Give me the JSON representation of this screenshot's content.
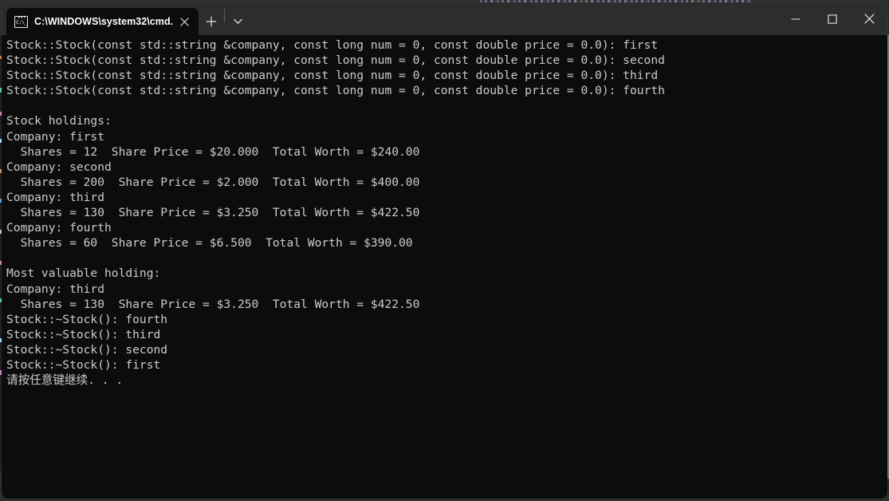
{
  "window": {
    "title": "C:\\WINDOWS\\system32\\cmd.",
    "controls": {
      "minimize_label": "Minimize",
      "maximize_label": "Maximize",
      "close_label": "Close"
    }
  },
  "tabbar": {
    "tabs": [
      {
        "title": "C:\\WINDOWS\\system32\\cmd.",
        "icon": "cmd-icon",
        "icon_text": "C:\\_",
        "active": true,
        "close_label": "Close tab"
      }
    ],
    "new_tab_label": "+",
    "dropdown_label": "Open new tab dropdown"
  },
  "colors": {
    "titlebar_bg": "#2d2d2d",
    "tab_active_bg": "#0c0c0c",
    "terminal_bg": "#0c0c0c",
    "terminal_fg": "#cccccc",
    "accent_text": "#ffffff"
  },
  "terminal": {
    "lines": [
      "Stock::Stock(const std::string &company, const long num = 0, const double price = 0.0): first",
      "Stock::Stock(const std::string &company, const long num = 0, const double price = 0.0): second",
      "Stock::Stock(const std::string &company, const long num = 0, const double price = 0.0): third",
      "Stock::Stock(const std::string &company, const long num = 0, const double price = 0.0): fourth",
      "",
      "Stock holdings:",
      "Company: first",
      "  Shares = 12  Share Price = $20.000  Total Worth = $240.00",
      "Company: second",
      "  Shares = 200  Share Price = $2.000  Total Worth = $400.00",
      "Company: third",
      "  Shares = 130  Share Price = $3.250  Total Worth = $422.50",
      "Company: fourth",
      "  Shares = 60  Share Price = $6.500  Total Worth = $390.00",
      "",
      "Most valuable holding:",
      "Company: third",
      "  Shares = 130  Share Price = $3.250  Total Worth = $422.50",
      "Stock::~Stock(): fourth",
      "Stock::~Stock(): third",
      "Stock::~Stock(): second",
      "Stock::~Stock(): first",
      "请按任意键继续. . ."
    ],
    "holdings": [
      {
        "company": "first",
        "shares": 12,
        "share_price": "$20.000",
        "total_worth": "$240.00"
      },
      {
        "company": "second",
        "shares": 200,
        "share_price": "$2.000",
        "total_worth": "$400.00"
      },
      {
        "company": "third",
        "shares": 130,
        "share_price": "$3.250",
        "total_worth": "$422.50"
      },
      {
        "company": "fourth",
        "shares": 60,
        "share_price": "$6.500",
        "total_worth": "$390.00"
      }
    ],
    "most_valuable": {
      "company": "third",
      "shares": 130,
      "share_price": "$3.250",
      "total_worth": "$422.50"
    },
    "prompt_text": "请按任意键继续. . ."
  }
}
